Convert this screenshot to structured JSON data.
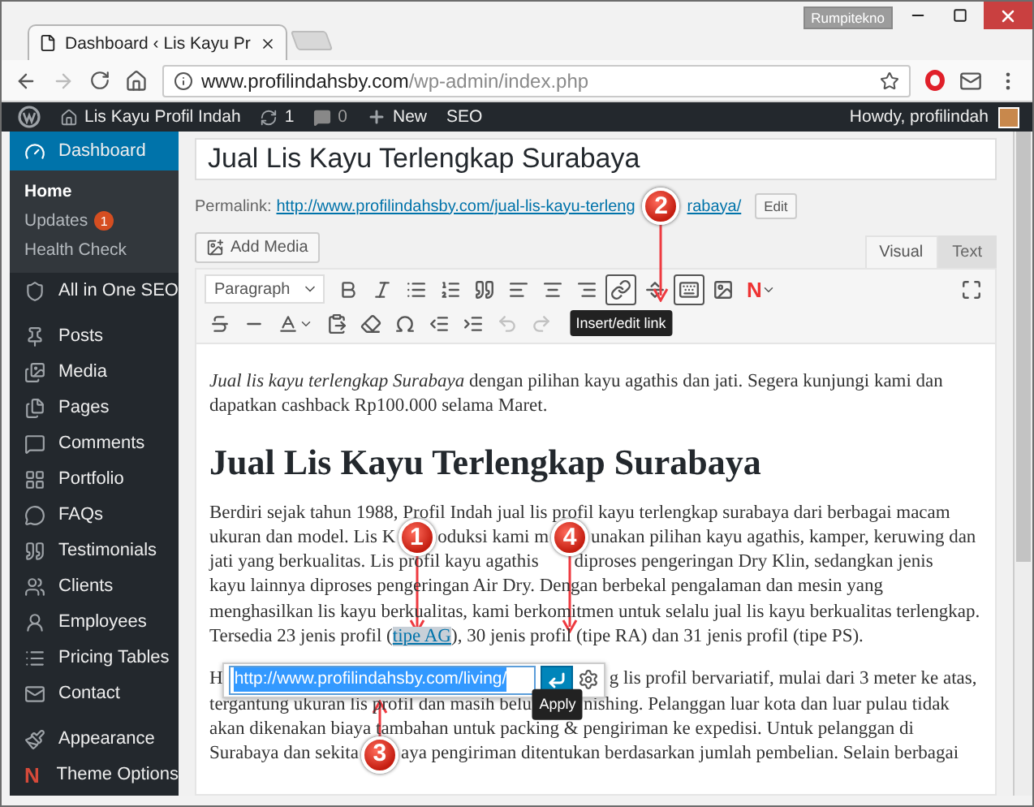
{
  "browser": {
    "account": "Rumpitekno",
    "tabs": [
      {
        "title": "Dashboard ‹ Lis Kayu Pr",
        "selected": true
      }
    ],
    "url_host": "www.profilindahsby.com",
    "url_path": "/wp-admin/index.php"
  },
  "admin_bar": {
    "site": "Lis Kayu Profil Indah",
    "updates": "1",
    "comments": "0",
    "new": "New",
    "seo": "SEO",
    "greeting": "Howdy, profilindah"
  },
  "sidebar": {
    "groups": [
      [
        {
          "label": "Dashboard",
          "selected": true,
          "children": [
            {
              "label": "Home",
              "selected": true
            },
            {
              "label": "Updates",
              "badge": "1",
              "selected": false
            },
            {
              "label": "Health Check",
              "selected": false
            }
          ]
        },
        {
          "label": "All in One SEO",
          "selected": false
        }
      ],
      [
        {
          "label": "Posts",
          "selected": false
        },
        {
          "label": "Media",
          "selected": false
        },
        {
          "label": "Pages",
          "selected": false
        },
        {
          "label": "Comments",
          "selected": false
        },
        {
          "label": "Portfolio",
          "selected": false
        },
        {
          "label": "FAQs",
          "selected": false
        },
        {
          "label": "Testimonials",
          "selected": false
        },
        {
          "label": "Clients",
          "selected": false
        },
        {
          "label": "Employees",
          "selected": false
        },
        {
          "label": "Pricing Tables",
          "selected": false
        },
        {
          "label": "Contact",
          "selected": false
        }
      ],
      [
        {
          "label": "Appearance",
          "selected": false
        },
        {
          "label": "Theme Options",
          "selected": false,
          "icon_text": "N"
        }
      ]
    ]
  },
  "editor": {
    "title": "Jual Lis Kayu Terlengkap Surabaya",
    "permalink": {
      "label": "Permalink:",
      "parts": [
        {
          "kind": "link",
          "text": "http://www.profilindahsby.com/jual-lis-kayu-terleng"
        },
        {
          "kind": "callout_down",
          "number": "2"
        },
        {
          "kind": "link",
          "text": "rabaya/"
        }
      ],
      "edit": "Edit"
    },
    "add_media": "Add Media",
    "tabs": [
      {
        "label": "Visual",
        "selected": true
      },
      {
        "label": "Text",
        "selected": false
      }
    ],
    "toolbar": {
      "format": "Paragraph",
      "rows": [
        [
          {
            "kind": "icon",
            "active": false
          },
          {
            "kind": "icon",
            "active": false
          },
          {
            "kind": "icon",
            "active": false
          },
          {
            "kind": "icon",
            "active": false
          },
          {
            "kind": "icon",
            "active": false
          },
          {
            "kind": "icon",
            "active": false
          },
          {
            "kind": "icon",
            "active": false
          },
          {
            "kind": "icon",
            "active": false
          },
          {
            "kind": "icon",
            "active": true,
            "tooltip": "Insert/edit link"
          },
          {
            "kind": "icon",
            "active": false
          },
          {
            "kind": "icon",
            "active": true
          },
          {
            "kind": "icon",
            "active": false
          },
          {
            "kind": "letter",
            "text": "N",
            "active": false
          },
          {
            "kind": "fullscreen",
            "active": false
          }
        ],
        [
          {
            "kind": "icon",
            "active": false
          },
          {
            "kind": "icon",
            "active": false
          },
          {
            "kind": "dropdown",
            "active": false
          },
          {
            "kind": "icon",
            "active": false
          },
          {
            "kind": "icon",
            "active": false
          },
          {
            "kind": "icon",
            "active": false
          },
          {
            "kind": "icon",
            "active": false
          },
          {
            "kind": "icon",
            "active": false
          },
          {
            "kind": "icon",
            "active": false,
            "disabled": true
          },
          {
            "kind": "icon",
            "active": false,
            "disabled": true
          }
        ]
      ]
    },
    "intro": "*Jual lis kayu terlengkap Surabaya* dengan pilihan kayu agathis dan jati. Segera kunjungi kami dan dapatkan cashback Rp100.000 selama Maret.",
    "heading": "Jual Lis Kayu Terlengkap Surabaya",
    "paragraphs": [
      [
        [
          {
            "kind": "text",
            "text": "Berdiri sejak tahun 1988, Profil Indah jual lis profil kayu terlengkap surabaya dari berbagai macam"
          }
        ],
        [
          {
            "kind": "text",
            "text": "ukuran dan model. Lis K"
          },
          {
            "kind": "callout_down",
            "number": "1"
          },
          {
            "kind": "text",
            "text": "oduksi kami m"
          },
          {
            "kind": "callout_down",
            "number": "4"
          },
          {
            "kind": "text",
            "text": "unakan pilihan kayu agathis, kamper, keruwing dan"
          }
        ],
        [
          {
            "kind": "text",
            "text": "jati yang berkualitas. Lis profil kayu agathis"
          },
          {
            "kind": "gap"
          },
          {
            "kind": "text",
            "text": "diproses pengeringan Dry Klin, sedangkan jenis"
          }
        ],
        [
          {
            "kind": "text",
            "text": "kayu lainnya diproses pengeringan Air Dry. Dengan berbekal pengalaman dan mesin yang"
          }
        ],
        [
          {
            "kind": "text",
            "text": "menghasilkan lis kayu berkualitas, kami berkomitmen untuk selalu jual lis kayu berkualitas terlengkap."
          }
        ],
        [
          {
            "kind": "text",
            "text": "Tersedia 23 jenis profil ("
          },
          {
            "kind": "link",
            "text": "tipe AG"
          },
          {
            "kind": "text",
            "text": "), 30 jenis profil (tipe RA) dan 31 jenis profil (tipe PS)."
          }
        ]
      ],
      [
        [
          {
            "kind": "text",
            "text": "H"
          },
          {
            "kind": "link_popup",
            "url": "http://www.profilindahsby.com/living/"
          },
          {
            "kind": "text",
            "text": "g lis profil bervariatif, mulai dari 3 meter ke atas,"
          }
        ],
        [
          {
            "kind": "text",
            "text": "tergantung ukuran lis profil dan masih belu"
          },
          {
            "kind": "tooltip",
            "text": "Apply"
          },
          {
            "kind": "text",
            "text": "nishing. Pelanggan luar kota dan luar pulau tidak"
          }
        ],
        [
          {
            "kind": "text",
            "text": "akan dikenakan biaya tambahan untuk packing & pengiriman ke expedisi. Untuk pelanggan di"
          }
        ],
        [
          {
            "kind": "text",
            "text": "Surabaya dan sekita"
          },
          {
            "kind": "callout_up",
            "number": "3"
          },
          {
            "kind": "text",
            "text": "aya pengiriman ditentukan berdasarkan jumlah pembelian. Selain berbagai"
          }
        ]
      ]
    ]
  }
}
